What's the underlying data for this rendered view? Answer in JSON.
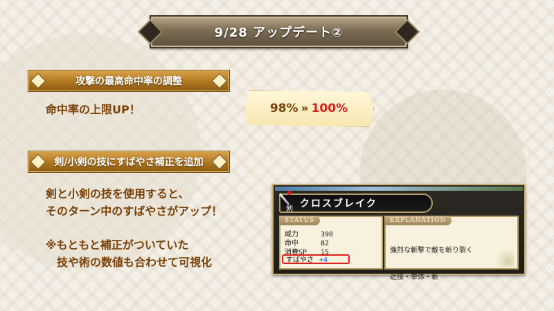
{
  "title": "9/28 アップデート②",
  "sections": [
    {
      "header": "攻撃の最高命中率の調整",
      "body": "命中率の上限UP！",
      "callout": {
        "from": "98%",
        "separator": "»",
        "to": "100%"
      }
    },
    {
      "header": "剣/小剣の技にすばやさ補正を追加",
      "body_lines": [
        "剣と小剣の技を使用すると、",
        "そのターン中のすばやさがアップ！"
      ],
      "note_lines": [
        "※もともと補正がついていた",
        "　技や術の数値も合わせて可視化"
      ]
    }
  ],
  "game_window": {
    "weapon_glyph": "剣",
    "skill_name": "クロスブレイク",
    "status_tab": "STATUS",
    "explanation_tab": "EXPLANATION",
    "stats": [
      {
        "label": "威力",
        "value": "390"
      },
      {
        "label": "命中",
        "value": "82"
      },
      {
        "label": "消費SP",
        "value": "15"
      }
    ],
    "agility": {
      "label": "すばやさ",
      "value": "+4"
    },
    "explanation_lines": [
      "強烈な斬撃で敵を斬り裂く",
      "近接・単体・斬"
    ],
    "colors": {
      "highlight_border": "#e21d1d",
      "bonus_value": "#3a86d6"
    }
  },
  "colors": {
    "body_text": "#7a4008",
    "accent_red": "#d81f1f",
    "ribbon_gold": "#b07620"
  }
}
